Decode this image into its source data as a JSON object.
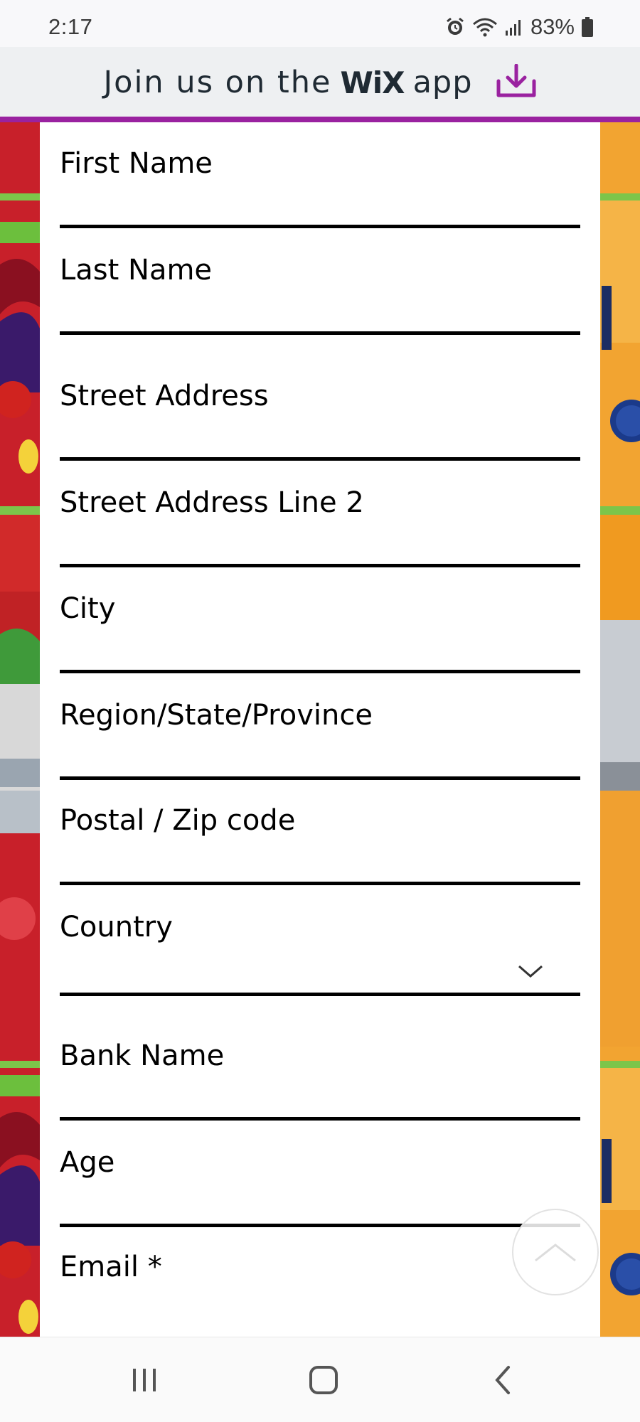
{
  "status_bar": {
    "time": "2:17",
    "battery": "83%",
    "icons": [
      "alarm-icon",
      "wifi-icon",
      "signal-icon",
      "battery-icon"
    ]
  },
  "banner": {
    "pre_text": "Join us on the",
    "logo_text": "WiX",
    "post_text": "app",
    "icon": "download-icon",
    "accent_color": "#9a22a0"
  },
  "form": {
    "fields": [
      {
        "label": "First Name"
      },
      {
        "label": "Last Name"
      },
      {
        "label": "Street Address"
      },
      {
        "label": "Street Address Line 2"
      },
      {
        "label": "City"
      },
      {
        "label": "Region/State/Province"
      },
      {
        "label": "Postal / Zip code"
      },
      {
        "label": "Country"
      },
      {
        "label": "Bank Name"
      },
      {
        "label": "Age"
      },
      {
        "label": "Email *"
      }
    ]
  },
  "nav": {
    "recents_icon": "recents-icon",
    "home_icon": "home-icon",
    "back_icon": "back-icon"
  }
}
